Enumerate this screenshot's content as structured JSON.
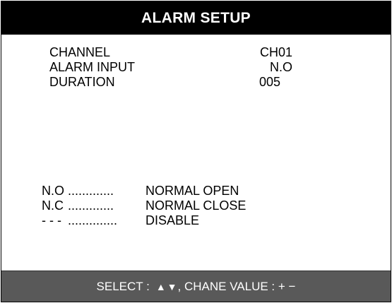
{
  "screen": {
    "title": "ALARM SETUP"
  },
  "settings": [
    {
      "label": "CHANNEL",
      "value": "CH01"
    },
    {
      "label": "ALARM INPUT",
      "value": "N.O"
    },
    {
      "label": "DURATION",
      "value": "005"
    }
  ],
  "legend": [
    {
      "code": "N.O",
      "leader": ".............",
      "meaning": "NORMAL OPEN"
    },
    {
      "code": "N.C",
      "leader": ".............",
      "meaning": "NORMAL CLOSE"
    },
    {
      "code": "- - -",
      "leader": "..............",
      "meaning": "DISABLE"
    }
  ],
  "footer": {
    "select_label": "SELECT :",
    "up_arrow": "▲",
    "down_arrow": "▼",
    "change_label": ", CHANE VALUE : + −"
  },
  "colors": {
    "title_bg": "#000000",
    "footer_bg": "#595959",
    "text": "#000000",
    "background": "#ffffff"
  }
}
